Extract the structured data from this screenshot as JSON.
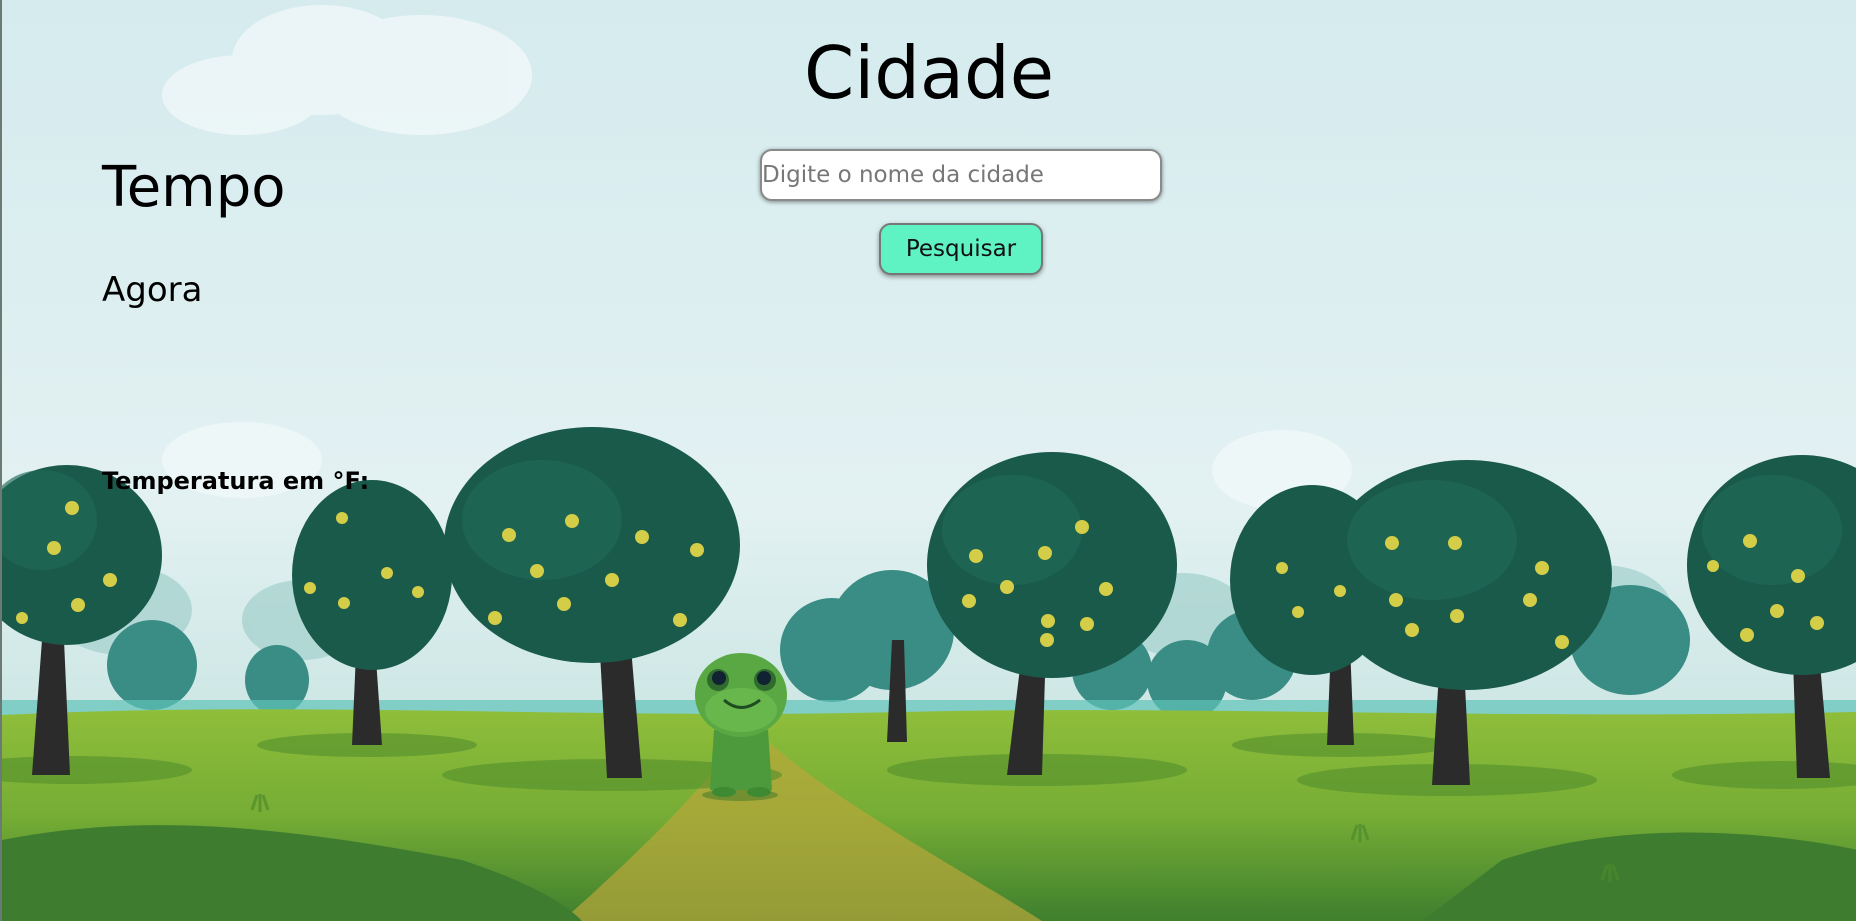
{
  "header": {
    "title": "Cidade"
  },
  "search": {
    "placeholder": "Digite o nome da cidade",
    "value": "",
    "button_label": "Pesquisar",
    "button_color": "#5ff3c4"
  },
  "weather": {
    "title": "Tempo",
    "now_label": "Agora",
    "temperature_label": "Temperatura em °F:"
  },
  "background": {
    "sky_color": "#d9eef0",
    "grass_color": "#7fb63a",
    "tree_color": "#1f5a4a",
    "fruit_color": "#d6cf4a",
    "character": "frog"
  }
}
